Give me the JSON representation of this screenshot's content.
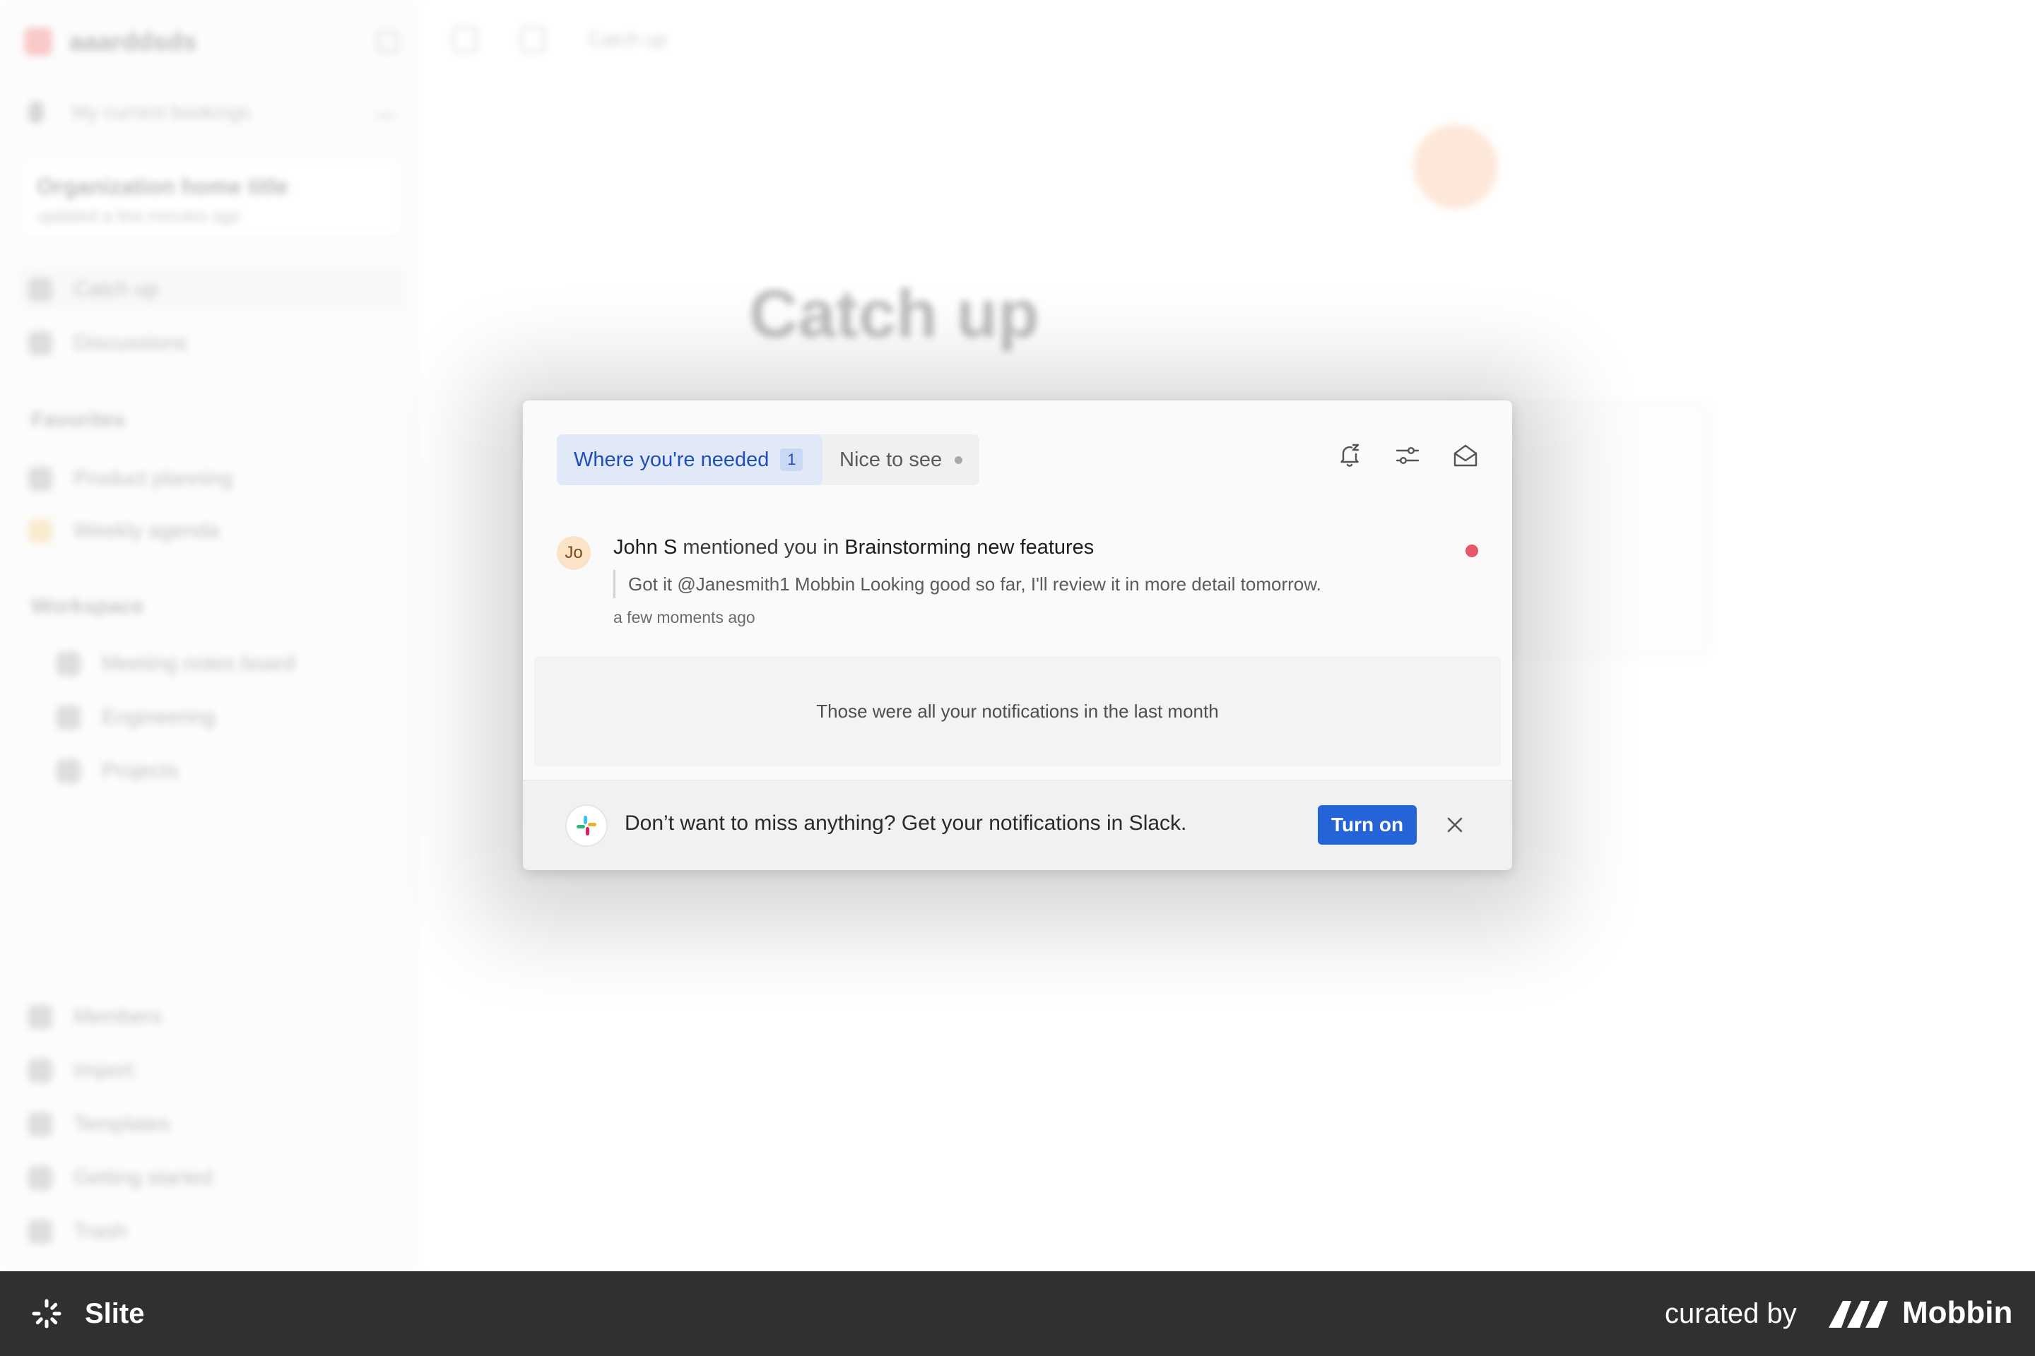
{
  "background": {
    "workspace_name": "aaarddsds",
    "search_placeholder": "My current bookings",
    "card_title": "Organization home title",
    "card_subtitle": "updated a few minutes ago",
    "nav_top": [
      "Catch up",
      "Discussions"
    ],
    "section_favorites": "Favorites",
    "favorites": [
      "Product planning",
      "Weekly agenda"
    ],
    "section_workspace": "Workspace",
    "workspace_items": [
      "Meeting notes board",
      "Engineering",
      "Projects"
    ],
    "nav_bottom": [
      "Members",
      "Import",
      "Templates",
      "Getting started",
      "Trash"
    ],
    "topbar_text": "Catch up",
    "page_heading": "Catch up"
  },
  "notifications": {
    "tabs": [
      {
        "label": "Where you're needed",
        "count": "1"
      },
      {
        "label": "Nice to see"
      }
    ],
    "toolbar": [
      "snooze-icon",
      "filter-sliders-icon",
      "mark-read-icon"
    ],
    "items": [
      {
        "avatar_initials": "Jo",
        "author": "John S",
        "action": "mentioned you in",
        "doc": "Brainstorming new features",
        "quote": "Got it @Janesmith1 Mobbin Looking good so far, I'll review it in more detail tomorrow.",
        "time": "a few moments ago",
        "unread": true
      }
    ],
    "end_message": "Those were all your notifications in the last month",
    "slack_prompt": "Don’t want to miss anything? Get your notifications in Slack.",
    "turn_on_label": "Turn on"
  },
  "brand_bar": {
    "app_name": "Slite",
    "curated_by": "curated by",
    "mobbin": "Mobbin"
  },
  "colors": {
    "accent": "#2563d8",
    "tab_active_bg": "#e1e9f8",
    "tab_active_text": "#1f4fb5",
    "unread": "#e5566b",
    "brand_bar": "#303030"
  }
}
